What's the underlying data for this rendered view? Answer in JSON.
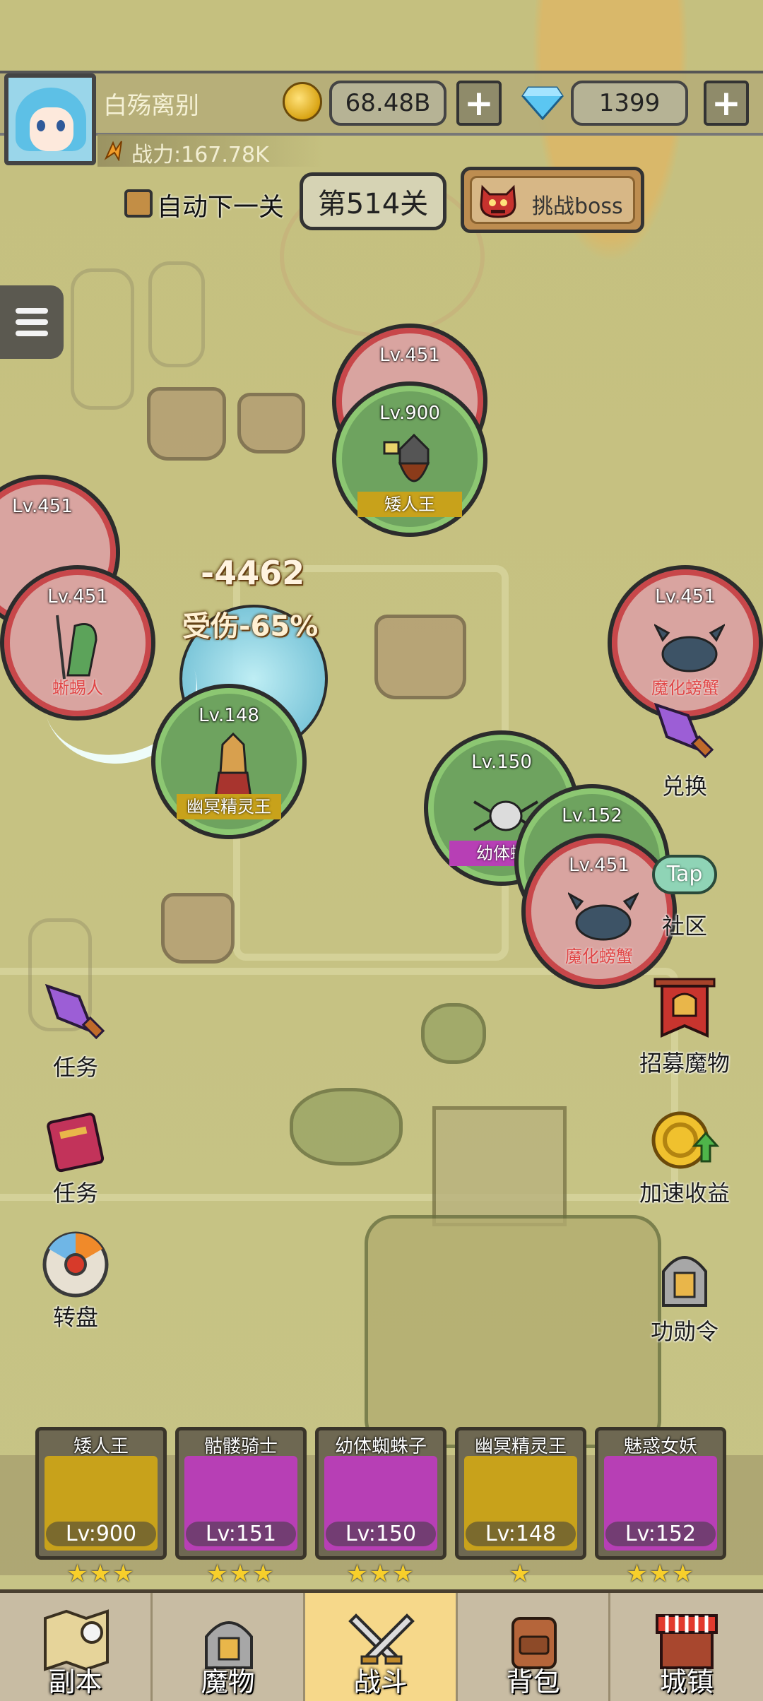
{
  "player": {
    "name": "白殇离别",
    "power": "战力:167.78K",
    "gold": "68.48B",
    "diamonds": "1399",
    "plus_label": "+"
  },
  "stage": {
    "auto_next_label": "自动下一关",
    "current": "第514关",
    "boss_button_label": "挑战boss"
  },
  "battle": {
    "units": [
      {
        "side": "enemy",
        "level": "Lv.451",
        "name": ""
      },
      {
        "side": "ally",
        "level": "Lv.900",
        "name": "矮人王"
      },
      {
        "side": "enemy",
        "level": "Lv.451",
        "name": ""
      },
      {
        "side": "enemy",
        "level": "Lv.451",
        "name": "蜥蜴人"
      },
      {
        "side": "ally",
        "level": "Lv.148",
        "name": "幽冥精灵王"
      },
      {
        "side": "enemy",
        "level": "Lv.451",
        "name": "魔化螃蟹"
      },
      {
        "side": "ally",
        "level": "Lv.150",
        "name": "幼体蜘"
      },
      {
        "side": "ally",
        "level": "Lv.152",
        "name": ""
      },
      {
        "side": "enemy",
        "level": "Lv.451",
        "name": "魔化螃蟹"
      }
    ],
    "damage_number": "-4462",
    "damage_taken": "受伤-65%"
  },
  "side_left": [
    {
      "label": "任务",
      "icon": "rocket-icon"
    },
    {
      "label": "任务",
      "icon": "book-icon"
    },
    {
      "label": "转盘",
      "icon": "wheel-icon"
    }
  ],
  "side_right": [
    {
      "label": "兑换",
      "icon": "rocket-icon"
    },
    {
      "label": "社区",
      "icon": "tap-cloud-icon",
      "badge": "Tap"
    },
    {
      "label": "招募魔物",
      "icon": "banner-helmet-icon"
    },
    {
      "label": "加速收益",
      "icon": "coin-up-icon"
    },
    {
      "label": "功勋令",
      "icon": "helmet-icon"
    }
  ],
  "roster": [
    {
      "name": "矮人王",
      "level": "Lv:900",
      "stars": "★★★",
      "color": "#c8a21b"
    },
    {
      "name": "骷髅骑士",
      "level": "Lv:151",
      "stars": "★★★",
      "color": "#b73fb5"
    },
    {
      "name": "幼体蜘蛛子",
      "level": "Lv:150",
      "stars": "★★★",
      "color": "#b73fb5"
    },
    {
      "name": "幽冥精灵王",
      "level": "Lv:148",
      "stars": "★",
      "color": "#c8a21b"
    },
    {
      "name": "魅惑女妖",
      "level": "Lv:152",
      "stars": "★★★",
      "color": "#b73fb5"
    }
  ],
  "nav": [
    {
      "label": "副本",
      "icon": "map-icon",
      "active": false
    },
    {
      "label": "魔物",
      "icon": "monster-helmet-icon",
      "active": false
    },
    {
      "label": "战斗",
      "icon": "crossed-swords-icon",
      "active": true
    },
    {
      "label": "背包",
      "icon": "backpack-icon",
      "active": false
    },
    {
      "label": "城镇",
      "icon": "shop-icon",
      "active": false
    }
  ]
}
